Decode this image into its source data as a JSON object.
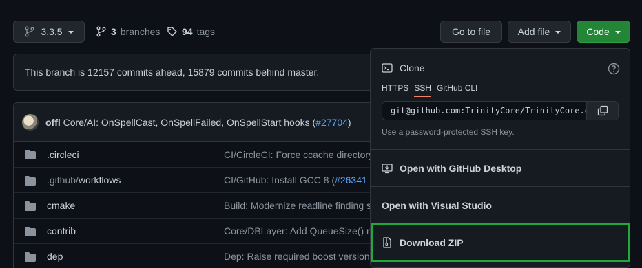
{
  "branch_select": {
    "label": "3.3.5"
  },
  "branches": {
    "count": "3",
    "label": "branches"
  },
  "tags": {
    "count": "94",
    "label": "tags"
  },
  "toolbar": {
    "goto_file": "Go to file",
    "add_file": "Add file",
    "code": "Code"
  },
  "notice": {
    "text": "This branch is 12157 commits ahead, 15879 commits behind master."
  },
  "commit": {
    "author": "offl",
    "message": "Core/AI: OnSpellCast, OnSpellFailed, OnSpellStart hooks (",
    "pr": "#27704",
    "close": ")"
  },
  "files": [
    {
      "name_prefix": "",
      "name": ".circleci",
      "msg": "CI/CircleCI: Force ccache directory (",
      "pr": ""
    },
    {
      "name_prefix": ".github/",
      "name": "workflows",
      "msg": "CI/GitHub: Install GCC 8 (",
      "pr": "#26341"
    },
    {
      "name_prefix": "",
      "name": "cmake",
      "msg": "Build: Modernize readline finding s",
      "pr": ""
    },
    {
      "name_prefix": "",
      "name": "contrib",
      "msg": "Core/DBLayer: Add QueueSize() me",
      "pr": ""
    },
    {
      "name_prefix": "",
      "name": "dep",
      "msg": "Dep: Raise required boost versions",
      "pr": ""
    }
  ],
  "clone": {
    "title": "Clone",
    "tabs": [
      "HTTPS",
      "SSH",
      "GitHub CLI"
    ],
    "active_tab": "SSH",
    "url": "git@github.com:TrinityCore/TrinityCore.git",
    "note": "Use a password-protected SSH key."
  },
  "menu": {
    "desktop": "Open with GitHub Desktop",
    "visual_studio": "Open with Visual Studio",
    "download_zip": "Download ZIP"
  },
  "colors": {
    "accent_green": "#238636",
    "highlight_green": "#22a83a",
    "link": "#58a6ff",
    "tab_underline": "#f78166"
  }
}
